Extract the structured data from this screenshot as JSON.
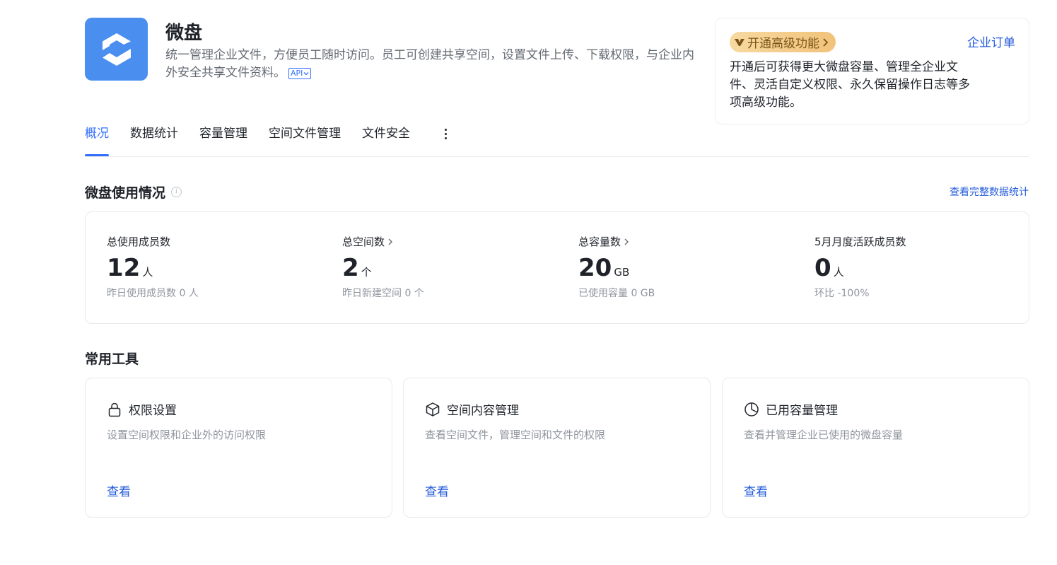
{
  "app": {
    "title": "微盘",
    "description": "统一管理企业文件，方便员工随时访问。员工可创建共享空间，设置文件上传、下载权限，与企业内外安全共享文件资料。",
    "api_badge": "API"
  },
  "upgrade": {
    "pill_label": "开通高级功能",
    "order_link": "企业订单",
    "description": "开通后可获得更大微盘容量、管理全企业文件、灵活自定义权限、永久保留操作日志等多项高级功能。"
  },
  "tabs": [
    {
      "label": "概况",
      "active": true
    },
    {
      "label": "数据统计",
      "active": false
    },
    {
      "label": "容量管理",
      "active": false
    },
    {
      "label": "空间文件管理",
      "active": false
    },
    {
      "label": "文件安全",
      "active": false
    }
  ],
  "usage": {
    "title": "微盘使用情况",
    "view_full_link": "查看完整数据统计",
    "stats": [
      {
        "label": "总使用成员数",
        "value": "12",
        "unit": "人",
        "sub": "昨日使用成员数 0 人",
        "has_arrow": false
      },
      {
        "label": "总空间数",
        "value": "2",
        "unit": "个",
        "sub": "昨日新建空间 0 个",
        "has_arrow": true
      },
      {
        "label": "总容量数",
        "value": "20",
        "unit": "GB",
        "sub": "已使用容量 0 GB",
        "has_arrow": true
      },
      {
        "label": "5月月度活跃成员数",
        "value": "0",
        "unit": "人",
        "sub": "环比 -100%",
        "has_arrow": false
      }
    ]
  },
  "tools": {
    "title": "常用工具",
    "items": [
      {
        "icon": "lock-icon",
        "name": "权限设置",
        "desc": "设置空间权限和企业外的访问权限",
        "link": "查看"
      },
      {
        "icon": "cube-icon",
        "name": "空间内容管理",
        "desc": "查看空间文件，管理空间和文件的权限",
        "link": "查看"
      },
      {
        "icon": "pie-chart-icon",
        "name": "已用容量管理",
        "desc": "查看并管理企业已使用的微盘容量",
        "link": "查看"
      }
    ]
  },
  "colors": {
    "accent": "#3370ff",
    "link": "#245bdb",
    "logo_bg": "#4a8ff0",
    "upgrade_pill": "#f1c27a"
  }
}
